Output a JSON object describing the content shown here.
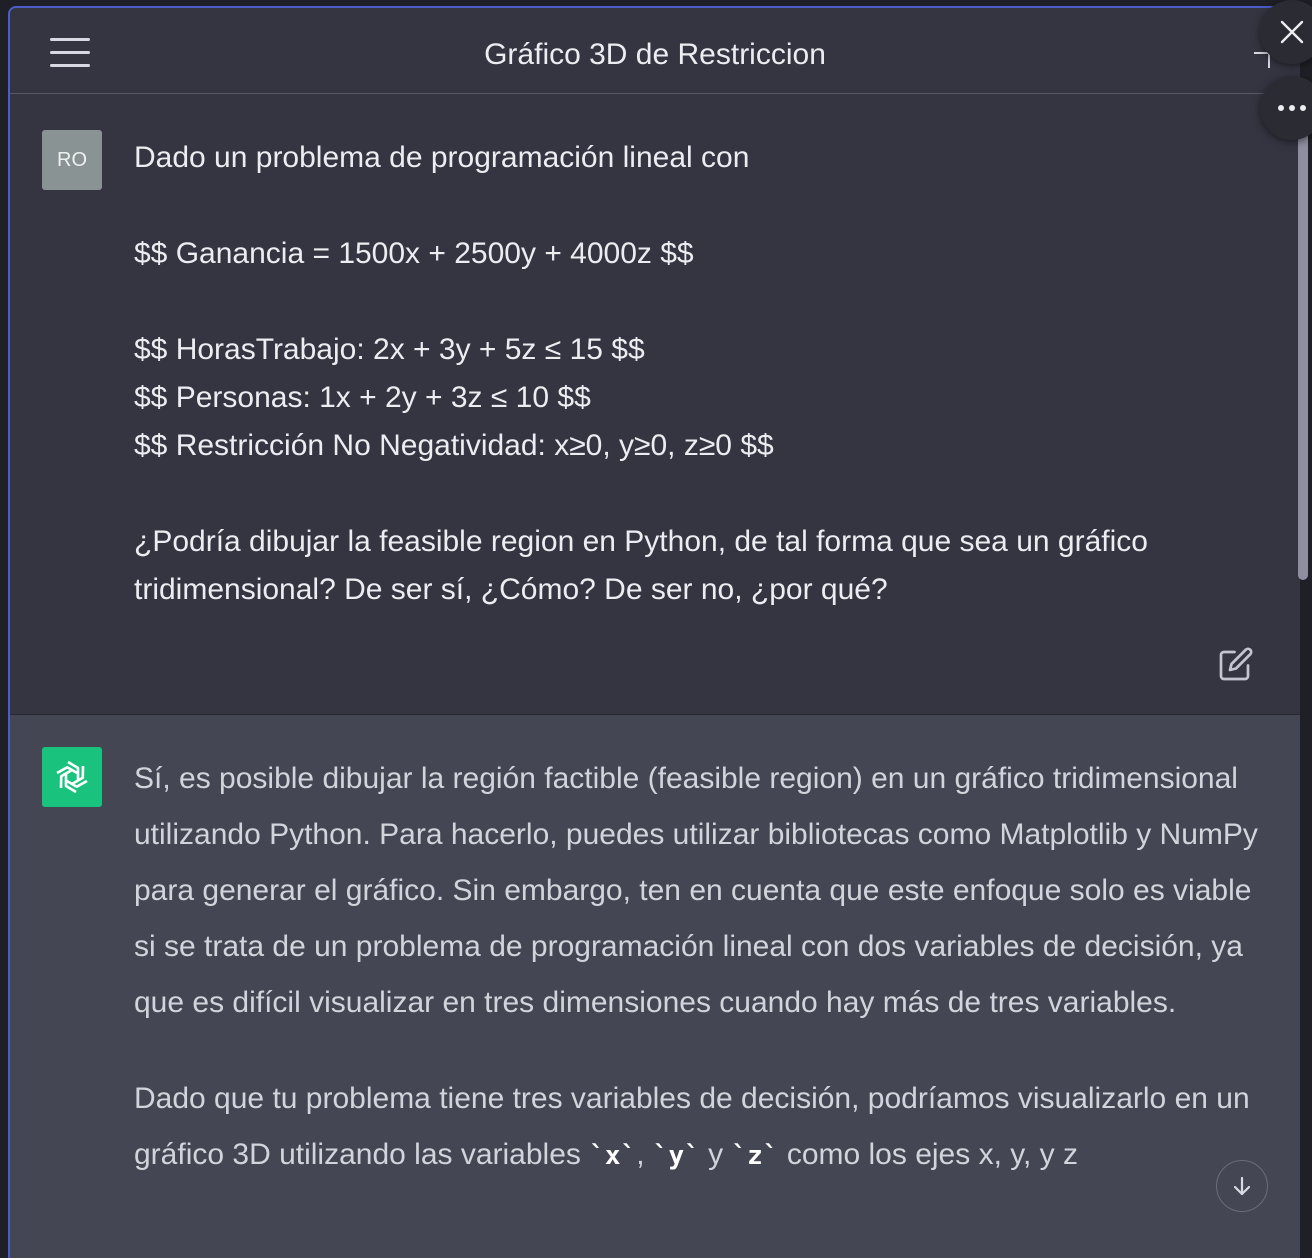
{
  "header": {
    "title": "Gráfico 3D de Restriccion",
    "menu_icon": "hamburger-menu-icon",
    "close_icon": "close-icon",
    "more_icon": "more-horizontal-icon"
  },
  "user_message": {
    "avatar_initials": "RO",
    "lines": [
      "Dado un problema de programación lineal con",
      "",
      "$$ Ganancia = 1500x + 2500y + 4000z $$",
      "",
      "$$ HorasTrabajo: 2x + 3y + 5z ≤ 15 $$",
      "$$ Personas: 1x + 2y + 3z ≤ 10 $$",
      "$$ Restricción No Negatividad: x≥0, y≥0, z≥0 $$",
      "",
      "¿Podría dibujar la feasible region en Python, de tal forma que sea un gráfico tridimensional? De ser sí, ¿Cómo? De ser no, ¿por qué?"
    ],
    "edit_icon": "edit-icon"
  },
  "assistant_message": {
    "avatar_icon": "openai-logo-icon",
    "paragraph1": "Sí, es posible dibujar la región factible (feasible region) en un gráfico tridimensional utilizando Python. Para hacerlo, puedes utilizar bibliotecas como Matplotlib y NumPy para generar el gráfico. Sin embargo, ten en cuenta que este enfoque solo es viable si se trata de un problema de programación lineal con dos variables de decisión, ya que es difícil visualizar en tres dimensiones cuando hay más de tres variables.",
    "paragraph2": {
      "text_before": "Dado que tu problema tiene tres variables de decisión, podríamos visualizarlo en un gráfico 3D utilizando las variables ",
      "code_x": "x",
      "sep1": ", ",
      "code_y": "y",
      "sep2": " y ",
      "code_z": "z",
      "text_after": " como los ejes x, y, y z"
    }
  },
  "scroll_down_icon": "arrow-down-icon"
}
